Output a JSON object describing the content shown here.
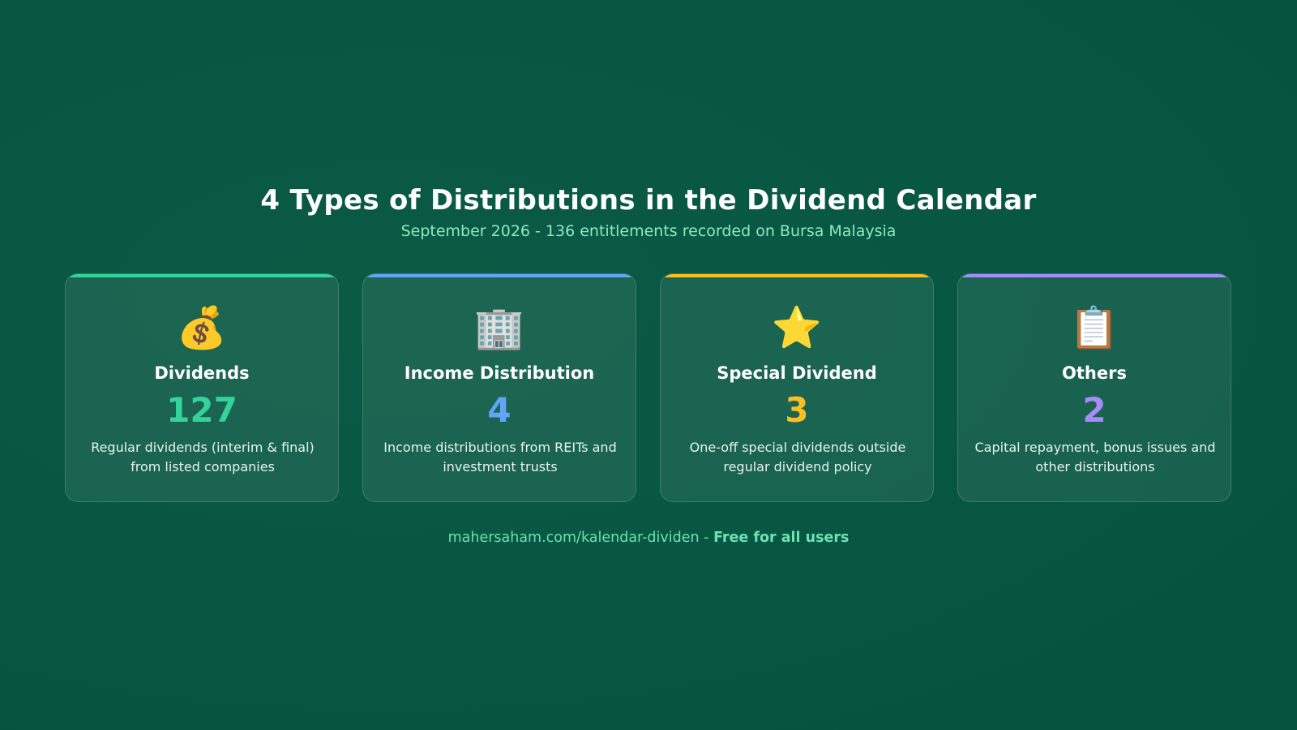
{
  "header": {
    "title": "4 Types of Distributions in the Dividend Calendar",
    "subtitle": "September 2026 - 136 entitlements recorded on Bursa Malaysia"
  },
  "cards": [
    {
      "icon": "money-bag-icon",
      "glyph": "💰",
      "title": "Dividends",
      "count": "127",
      "description": "Regular dividends (interim & final) from listed companies",
      "accent": "#34d399"
    },
    {
      "icon": "office-building-icon",
      "glyph": "🏢",
      "title": "Income Distribution",
      "count": "4",
      "description": "Income distributions from REITs and investment trusts",
      "accent": "#60a5fa"
    },
    {
      "icon": "star-icon",
      "glyph": "⭐",
      "title": "Special Dividend",
      "count": "3",
      "description": "One-off special dividends outside regular dividend policy",
      "accent": "#fbbf24"
    },
    {
      "icon": "clipboard-icon",
      "glyph": "📋",
      "title": "Others",
      "count": "2",
      "description": "Capital repayment, bonus issues and other distributions",
      "accent": "#a78bfa"
    }
  ],
  "footer": {
    "link": "mahersaham.com/kalendar-dividen",
    "separator": "-",
    "note": "Free for all users"
  },
  "colors": {
    "background": "#075743",
    "subtitle": "#8ee8bf",
    "footer": "#6ee2b0"
  }
}
